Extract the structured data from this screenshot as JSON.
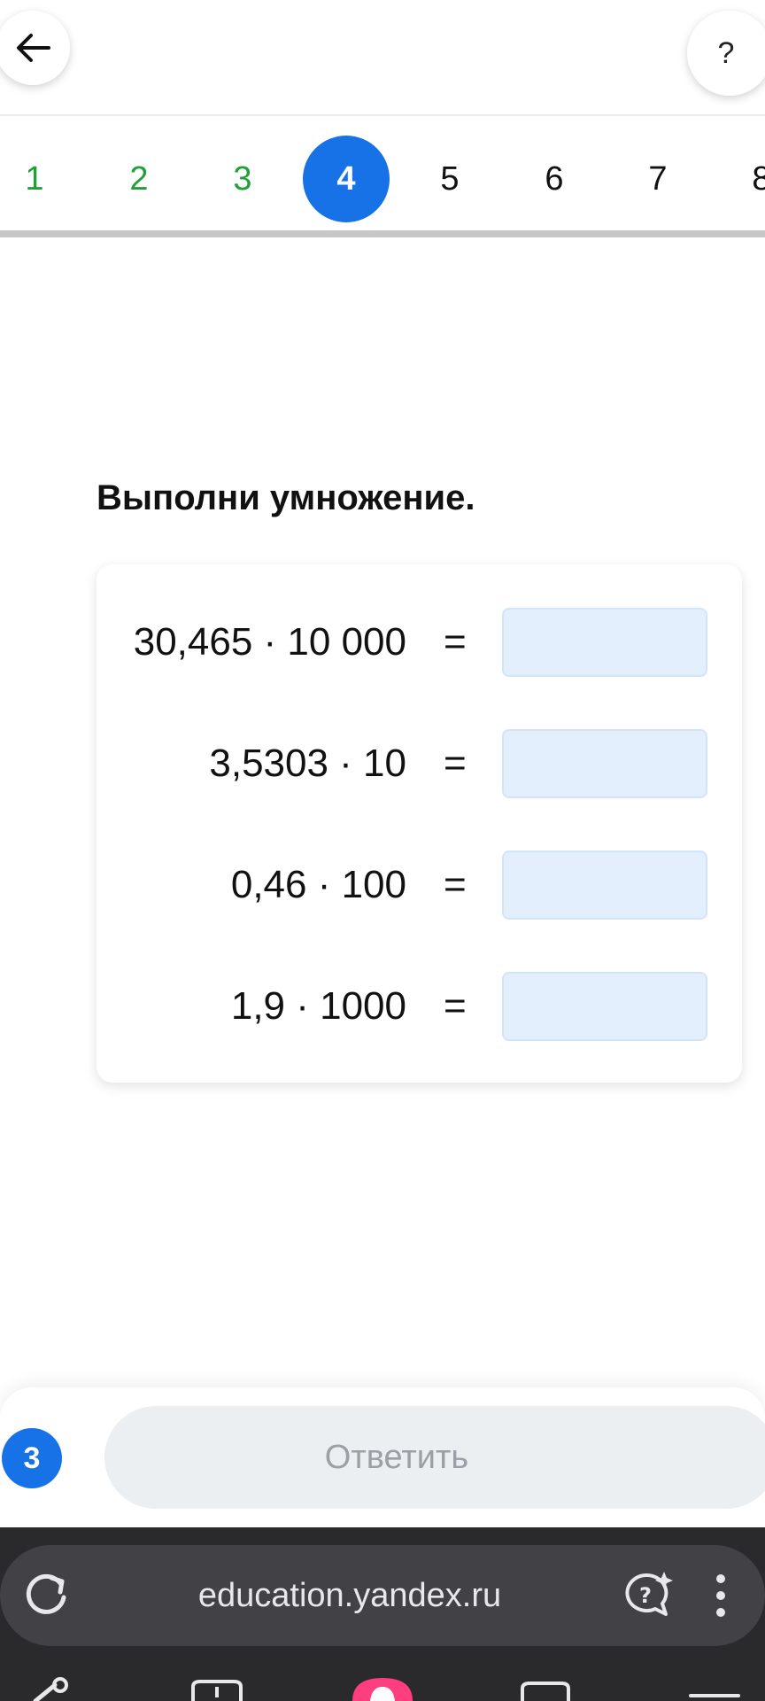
{
  "header": {
    "back_icon": "arrow-left-icon",
    "help_label": "?"
  },
  "stepper": {
    "steps": [
      {
        "label": "1",
        "state": "done"
      },
      {
        "label": "2",
        "state": "done"
      },
      {
        "label": "3",
        "state": "done"
      },
      {
        "label": "4",
        "state": "current"
      },
      {
        "label": "5",
        "state": "pending"
      },
      {
        "label": "6",
        "state": "pending"
      },
      {
        "label": "7",
        "state": "pending"
      },
      {
        "label": "8",
        "state": "pending"
      }
    ],
    "colors": {
      "done": "#21a038",
      "current": "#1672e6"
    }
  },
  "task": {
    "title": "Выполни умножение.",
    "rows": [
      {
        "expression": "30,465 · 10 000",
        "equals": "=",
        "answer": ""
      },
      {
        "expression": "3,5303 · 10",
        "equals": "=",
        "answer": ""
      },
      {
        "expression": "0,46 · 100",
        "equals": "=",
        "answer": ""
      },
      {
        "expression": "1,9 · 1000",
        "equals": "=",
        "answer": ""
      }
    ]
  },
  "answer_bar": {
    "attempts": "3",
    "submit_label": "Ответить"
  },
  "browser": {
    "url": "education.yandex.ru",
    "icons": [
      "reload-icon",
      "ai-assistant-icon",
      "more-vertical-icon"
    ]
  }
}
